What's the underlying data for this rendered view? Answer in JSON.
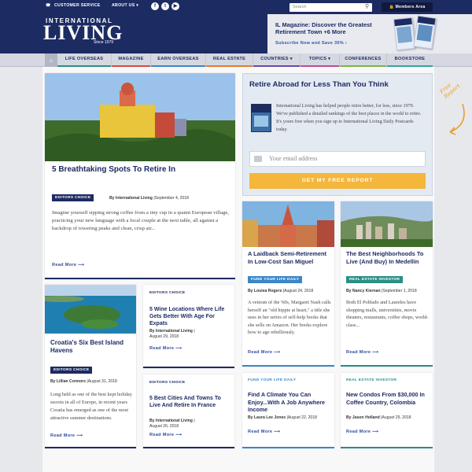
{
  "topbar": {
    "customer_service": "Customer Service",
    "about_us": "About Us",
    "search_placeholder": "Search",
    "members_area": "Members Area"
  },
  "header": {
    "logo_line1": "INTERNATIONAL",
    "logo_line2": "LIVING",
    "logo_since": "Since 1979",
    "promo_title": "IL Magazine: Discover the Greatest Retirement Town +6 More",
    "promo_cta": "Subscribe Now and Save 35%"
  },
  "nav": [
    "Life Overseas",
    "Magazine",
    "Earn Overseas",
    "Real Estate",
    "Countries",
    "Topics",
    "Conferences",
    "Bookstore"
  ],
  "signup": {
    "heading": "Retire Abroad for Less Than You Think",
    "text": "International Living has helped people retire better, for less, since 1979. We've published a detailed rankings of the best places in the world to retire. It's yours free when you sign up to International Living Daily Postcards today.",
    "email_placeholder": "Your email address",
    "button": "Get My Free Report",
    "handwritten": "Free Report"
  },
  "featured": {
    "title": "5 Breathtaking Spots To Retire In",
    "badge": "Editors Choice",
    "author": "By International Living",
    "date": "September 4, 2018",
    "excerpt": "Imagine yourself sipping strong coffee from a tiny cup in a quaint European village, practicing your new language with a local couple at the next table, all against a backdrop of towering peaks and clean, crisp air...",
    "read_more": "Read More"
  },
  "croatia": {
    "title": "Croatia's Six Best Island Havens",
    "badge": "Editors Choice",
    "author": "By Lillian Connors",
    "date": "August 31, 2018",
    "excerpt": "Long held as one of the best kept holiday secrets in all of Europe, in recent years Croatia has emerged as one of the most attractive summer destinations.",
    "read_more": "Read More"
  },
  "wine": {
    "badge": "Editors Choice",
    "title": "5 Wine Locations Where Life Gets Better With Age For Expats",
    "author": "By International Living",
    "date": "August 29, 2018",
    "read_more": "Read More"
  },
  "cities": {
    "badge": "Editors Choice",
    "title": "5 Best Cities And Towns To Live And Retire In France",
    "author": "By International Living",
    "date": "August 26, 2018",
    "read_more": "Read More"
  },
  "sanmiguel": {
    "title": "A Laidback Semi-Retirement In Low-Cost San Miguel",
    "badge": "Fund Your Life Daily",
    "author": "By Louisa Rogers",
    "date": "August 24, 2018",
    "excerpt": "A veteran of the '60s, Margaret Nash calls herself an \"old hippie at heart,\" a title she uses in her series of self-help books that she sells on Amazon. Her books explore how to age rebelliously.",
    "read_more": "Read More"
  },
  "medellin": {
    "title": "The Best Neighborhoods To Live (And Buy) In Medellín",
    "badge": "Real Estate Investor",
    "author": "By Nancy Kiernan",
    "date": "September 1, 2018",
    "excerpt": "Both El Poblado and Laureles have shopping malls, universities, movie theaters, restaurants, coffee shops, world-class...",
    "read_more": "Read More"
  },
  "climate": {
    "badge": "Fund Your Life Daily",
    "title": "Find A Climate You Can Enjoy...With A Job Anywhere Income",
    "author": "By Laura Lee Jones",
    "date": "August 22, 2018",
    "read_more": "Read More"
  },
  "condos": {
    "badge": "Real Estate Investor",
    "title": "New Condos From $30,000 In Coffee Country, Colombia",
    "author": "By Jason Holland",
    "date": "August 29, 2018",
    "read_more": "Read More"
  },
  "colors": {
    "navy": "#1d2b63",
    "gold": "#f4b63b",
    "teal": "#2a8f86",
    "blue": "#3a86c8"
  }
}
